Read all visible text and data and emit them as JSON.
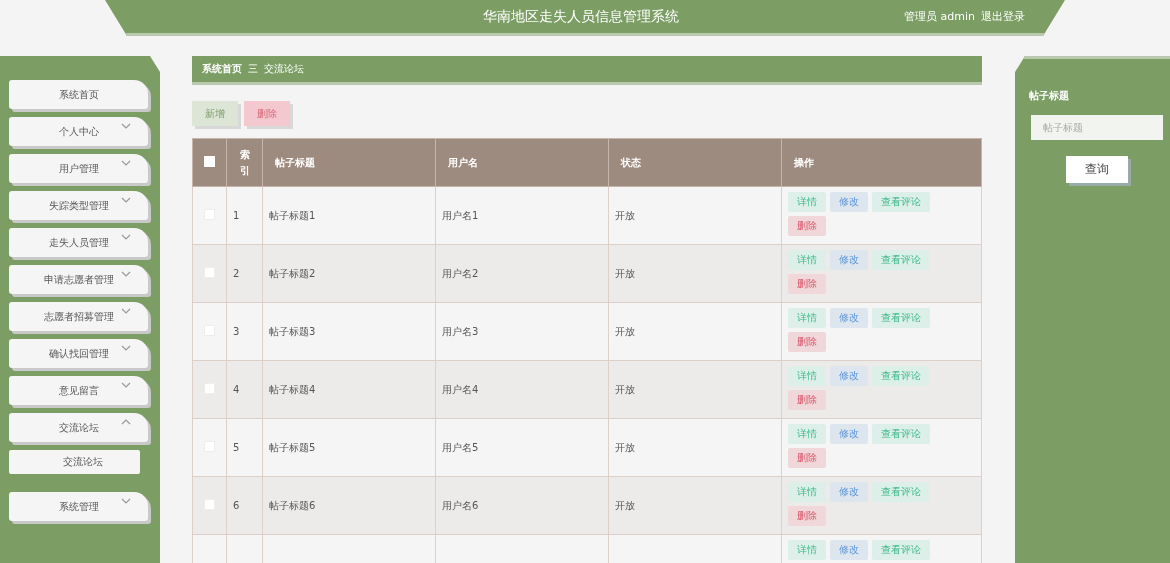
{
  "header": {
    "title": "华南地区走失人员信息管理系统",
    "user": "管理员 admin",
    "logout": "退出登录"
  },
  "sidebar": {
    "items": [
      {
        "label": "系统首页",
        "kind": "link"
      },
      {
        "label": "个人中心",
        "kind": "group",
        "expanded": false
      },
      {
        "label": "用户管理",
        "kind": "group",
        "expanded": false
      },
      {
        "label": "失踪类型管理",
        "kind": "group",
        "expanded": false
      },
      {
        "label": "走失人员管理",
        "kind": "group",
        "expanded": false
      },
      {
        "label": "申请志愿者管理",
        "kind": "group",
        "expanded": false
      },
      {
        "label": "志愿者招募管理",
        "kind": "group",
        "expanded": false
      },
      {
        "label": "确认找回管理",
        "kind": "group",
        "expanded": false
      },
      {
        "label": "意见留言",
        "kind": "group",
        "expanded": false
      },
      {
        "label": "交流论坛",
        "kind": "group",
        "expanded": true,
        "children": [
          {
            "label": "交流论坛"
          }
        ]
      },
      {
        "label": "系统管理",
        "kind": "group",
        "expanded": false
      }
    ]
  },
  "breadcrumb": {
    "home": "系统首页",
    "separator": "三",
    "current": "交流论坛"
  },
  "toolbar": [
    {
      "label": "新增",
      "kind": "add"
    },
    {
      "label": "删除",
      "kind": "delete"
    }
  ],
  "table": {
    "columns": [
      "索引",
      "帖子标题",
      "用户名",
      "状态",
      "操作"
    ],
    "select_all": {
      "checked": false
    },
    "rows": [
      {
        "checked": false,
        "index": "1",
        "title": "帖子标题1",
        "username": "用户名1",
        "status": "开放",
        "actions": [
          {
            "label": "详情",
            "kind": "detail"
          },
          {
            "label": "修改",
            "kind": "edit"
          },
          {
            "label": "查看评论",
            "kind": "comments"
          },
          {
            "label": "删除",
            "kind": "delete"
          }
        ]
      },
      {
        "checked": false,
        "index": "2",
        "title": "帖子标题2",
        "username": "用户名2",
        "status": "开放",
        "actions": [
          {
            "label": "详情",
            "kind": "detail"
          },
          {
            "label": "修改",
            "kind": "edit"
          },
          {
            "label": "查看评论",
            "kind": "comments"
          },
          {
            "label": "删除",
            "kind": "delete"
          }
        ]
      },
      {
        "checked": false,
        "index": "3",
        "title": "帖子标题3",
        "username": "用户名3",
        "status": "开放",
        "actions": [
          {
            "label": "详情",
            "kind": "detail"
          },
          {
            "label": "修改",
            "kind": "edit"
          },
          {
            "label": "查看评论",
            "kind": "comments"
          },
          {
            "label": "删除",
            "kind": "delete"
          }
        ]
      },
      {
        "checked": false,
        "index": "4",
        "title": "帖子标题4",
        "username": "用户名4",
        "status": "开放",
        "actions": [
          {
            "label": "详情",
            "kind": "detail"
          },
          {
            "label": "修改",
            "kind": "edit"
          },
          {
            "label": "查看评论",
            "kind": "comments"
          },
          {
            "label": "删除",
            "kind": "delete"
          }
        ]
      },
      {
        "checked": false,
        "index": "5",
        "title": "帖子标题5",
        "username": "用户名5",
        "status": "开放",
        "actions": [
          {
            "label": "详情",
            "kind": "detail"
          },
          {
            "label": "修改",
            "kind": "edit"
          },
          {
            "label": "查看评论",
            "kind": "comments"
          },
          {
            "label": "删除",
            "kind": "delete"
          }
        ]
      },
      {
        "checked": false,
        "index": "6",
        "title": "帖子标题6",
        "username": "用户名6",
        "status": "开放",
        "actions": [
          {
            "label": "详情",
            "kind": "detail"
          },
          {
            "label": "修改",
            "kind": "edit"
          },
          {
            "label": "查看评论",
            "kind": "comments"
          },
          {
            "label": "删除",
            "kind": "delete"
          }
        ]
      },
      {
        "actions": [
          {
            "label": "详情",
            "kind": "detail"
          },
          {
            "label": "修改",
            "kind": "edit"
          },
          {
            "label": "查看评论",
            "kind": "comments"
          }
        ]
      }
    ]
  },
  "search": {
    "label": "帖子标题",
    "placeholder": "帖子标题",
    "button": "查询"
  }
}
